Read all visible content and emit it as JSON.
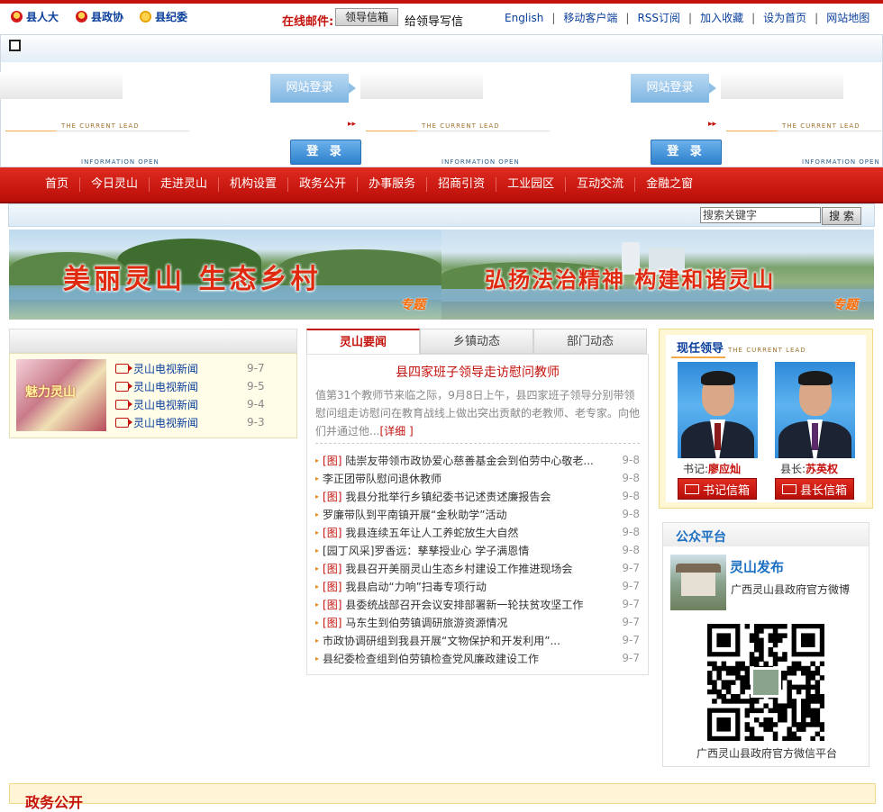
{
  "colors": {
    "brand_red": "#c4120d",
    "link_blue": "#0a3f9c",
    "accent_orange": "#f3a94a",
    "panel_yellow": "#fff7d4"
  },
  "topbar": {
    "councils": [
      "县人大",
      "县政协",
      "县纪委"
    ],
    "mail_label": "在线邮件:",
    "mail_button": "领导信箱",
    "mail_link": "给领导写信",
    "links": [
      "English",
      "移动客户端",
      "RSS订阅",
      "加入收藏",
      "设为首页",
      "网站地图"
    ]
  },
  "login": {
    "site_login": "网站登录",
    "button": "登 录",
    "lead_text": "THE CURRENT LEAD",
    "info_text": "INFORMATION OPEN"
  },
  "nav": [
    "首页",
    "今日灵山",
    "走进灵山",
    "机构设置",
    "政务公开",
    "办事服务",
    "招商引资",
    "工业园区",
    "互动交流",
    "金融之窗"
  ],
  "search": {
    "placeholder": "搜索关键字",
    "button": "搜 索"
  },
  "banners": [
    {
      "title": "美丽灵山  生态乡村",
      "tag": "专题"
    },
    {
      "title": "弘扬法治精神  构建和谐灵山",
      "tag": "专题"
    }
  ],
  "tv": {
    "thumb_text": "魅力灵山",
    "items": [
      {
        "title": "灵山电视新闻",
        "date": "9-7"
      },
      {
        "title": "灵山电视新闻",
        "date": "9-5"
      },
      {
        "title": "灵山电视新闻",
        "date": "9-4"
      },
      {
        "title": "灵山电视新闻",
        "date": "9-3"
      }
    ]
  },
  "news": {
    "tabs": [
      "灵山要闻",
      "乡镇动态",
      "部门动态"
    ],
    "headline": "县四家班子领导走访慰问教师",
    "summary": "值第31个教师节来临之际，9月8日上午，县四家班子领导分别带领慰问组走访慰问在教育战线上做出突出贡献的老教师、老专家。向他们并通过他...",
    "more": "[详细 ]",
    "items": [
      {
        "img": true,
        "title": "陆崇友带领市政协爱心慈善基金会到伯劳中心敬老...",
        "date": "9-8"
      },
      {
        "img": false,
        "title": "李正团带队慰问退休教师",
        "date": "9-8"
      },
      {
        "img": true,
        "title": "我县分批举行乡镇纪委书记述责述廉报告会",
        "date": "9-8"
      },
      {
        "img": false,
        "title": "罗廉带队到平南镇开展“金秋助学”活动",
        "date": "9-8"
      },
      {
        "img": true,
        "title": "我县连续五年让人工养蛇放生大自然",
        "date": "9-8"
      },
      {
        "img": false,
        "title": "[园丁风采]罗香远：孳孳授业心  学子满恩情",
        "date": "9-8"
      },
      {
        "img": true,
        "title": "我县召开美丽灵山生态乡村建设工作推进现场会",
        "date": "9-7"
      },
      {
        "img": true,
        "title": "我县启动“力响”扫毒专项行动",
        "date": "9-7"
      },
      {
        "img": true,
        "title": "县委统战部召开会议安排部署新一轮扶贫攻坚工作",
        "date": "9-7"
      },
      {
        "img": true,
        "title": "马东生到伯劳镇调研旅游资源情况",
        "date": "9-7"
      },
      {
        "img": false,
        "title": "市政协调研组到我县开展“文物保护和开发利用”...",
        "date": "9-7"
      },
      {
        "img": false,
        "title": "县纪委检查组到伯劳镇检查党风廉政建设工作",
        "date": "9-7"
      }
    ],
    "img_tag": "[图]"
  },
  "leaders": {
    "title": "现任领导",
    "subtitle": "THE CURRENT LEAD",
    "people": [
      {
        "role": "书记:",
        "name": "廖应灿",
        "mail": "书记信箱"
      },
      {
        "role": "县长:",
        "name": "苏英权",
        "mail": "县长信箱"
      }
    ]
  },
  "public": {
    "title": "公众平台",
    "name": "灵山发布",
    "desc": "广西灵山县政府官方微博",
    "qr_caption": "广西灵山县政府官方微信平台"
  },
  "bottom": {
    "title": "政务公开"
  }
}
